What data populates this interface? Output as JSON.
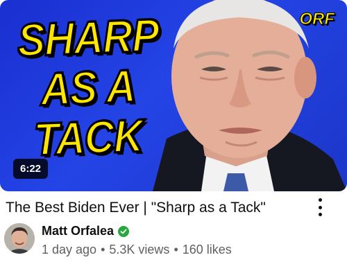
{
  "video": {
    "thumbnail": {
      "overlay_lines": [
        "SHARP",
        "AS A",
        "TACK"
      ],
      "brand_logo": "ORF",
      "duration": "6:22",
      "overlay_color": "#ffe600",
      "background_color": "#2140dc"
    },
    "title": "The Best Biden Ever | \"Sharp as a Tack\"",
    "more_icon": "vertical-ellipsis-icon",
    "channel": {
      "name": "Matt Orfalea",
      "verified_icon": "verified-check-icon",
      "verified_color": "#2ba640"
    },
    "stats": {
      "age": "1 day ago",
      "views": "5.3K views",
      "likes": "160 likes"
    }
  }
}
